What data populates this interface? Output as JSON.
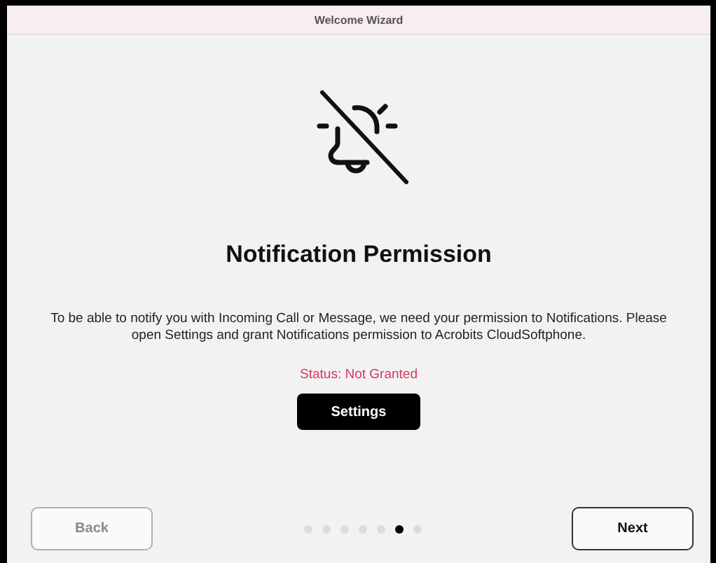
{
  "window": {
    "title": "Welcome Wizard"
  },
  "heading": "Notification Permission",
  "message": "To be able to notify you with Incoming Call or Message, we need your permission to Notifications. Please open Settings and grant Notifications permission to Acrobits CloudSoftphone.",
  "status": "Status: Not Granted",
  "settings_button": "Settings",
  "back_button": {
    "label": "Back",
    "disabled": true
  },
  "next_button": {
    "label": "Next",
    "disabled": false
  },
  "pages": [
    {
      "selected": false
    },
    {
      "selected": false
    },
    {
      "selected": false
    },
    {
      "selected": false
    },
    {
      "selected": false
    },
    {
      "selected": true
    },
    {
      "selected": false
    }
  ]
}
